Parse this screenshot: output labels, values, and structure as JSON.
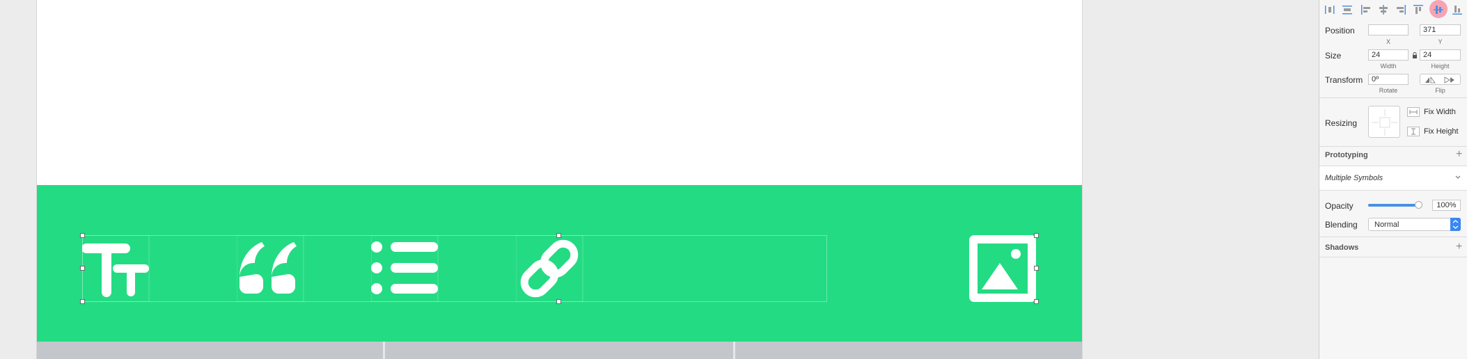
{
  "inspector": {
    "align_tools": [
      "distribute-horizontal-icon",
      "distribute-vertical-icon",
      "align-left-icon",
      "align-center-horizontal-icon",
      "align-right-icon",
      "align-top-icon",
      "align-middle-vertical-icon",
      "align-bottom-icon"
    ],
    "position": {
      "label": "Position",
      "x_value": "",
      "y_value": "371",
      "x_caption": "X",
      "y_caption": "Y"
    },
    "size": {
      "label": "Size",
      "width_value": "24",
      "height_value": "24",
      "width_caption": "Width",
      "height_caption": "Height"
    },
    "transform": {
      "label": "Transform",
      "rotate_value": "0º",
      "rotate_caption": "Rotate",
      "flip_caption": "Flip"
    },
    "resizing": {
      "label": "Resizing",
      "fix_width": "Fix Width",
      "fix_height": "Fix Height"
    },
    "prototyping": {
      "title": "Prototyping",
      "add": "+"
    },
    "symbols": {
      "value": "Multiple Symbols"
    },
    "opacity": {
      "label": "Opacity",
      "value": "100%",
      "level": 1.0
    },
    "blending": {
      "label": "Blending",
      "value": "Normal"
    },
    "shadows": {
      "title": "Shadows",
      "add": "+"
    }
  },
  "canvas": {
    "toolbar_color": "#23db83",
    "icons": [
      "text-size-icon",
      "quote-icon",
      "list-icon",
      "link-icon",
      "image-icon"
    ]
  }
}
